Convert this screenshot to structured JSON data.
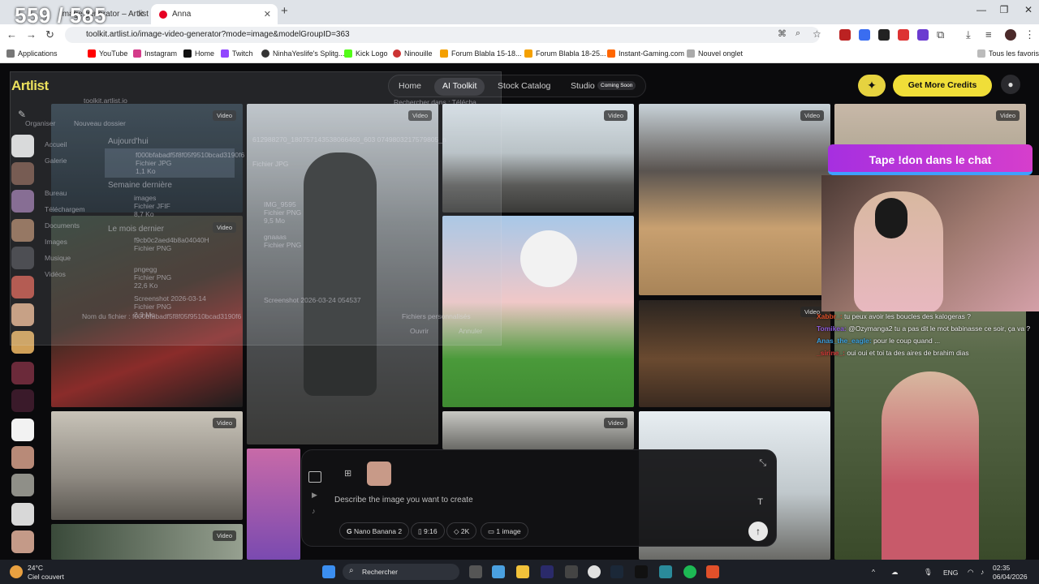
{
  "overlay_counter": "559 / 585",
  "browser": {
    "tabs": [
      {
        "label": "Image generator – Artlist"
      },
      {
        "label": "Anna"
      }
    ],
    "url": "toolkit.artlist.io/image-video-generator?mode=image&modelGroupID=363",
    "bookmarks": [
      {
        "label": "Applications"
      },
      {
        "label": "YouTube"
      },
      {
        "label": "Instagram"
      },
      {
        "label": "Home"
      },
      {
        "label": "Twitch"
      },
      {
        "label": "NinhaYeslife's Splitg..."
      },
      {
        "label": "Kick Logo"
      },
      {
        "label": "Ninouille"
      },
      {
        "label": "Forum Blabla 15-18..."
      },
      {
        "label": "Forum Blabla 18-25..."
      },
      {
        "label": "Instant-Gaming.com"
      },
      {
        "label": "Nouvel onglet"
      }
    ],
    "all_bookmarks": "Tous les favoris"
  },
  "artlist": {
    "logo": "Artlist",
    "nav": {
      "home": "Home",
      "ai_toolkit": "AI Toolkit",
      "stock": "Stock Catalog",
      "studio": "Studio",
      "coming_soon": "Coming Soon"
    },
    "credits_button": "Get More Credits",
    "video_badge": "Video",
    "prompt": {
      "placeholder": "Describe the image you want to create",
      "model": "Nano Banana 2",
      "ratio": "9:16",
      "resolution": "2K",
      "count": "1 image"
    }
  },
  "file_dialog": {
    "address": "toolkit.artlist.io",
    "search": "Rechercher dans : Télécha...",
    "organize": "Organiser",
    "new_folder": "Nouveau dossier",
    "tree": [
      "Accueil",
      "Galerie",
      "Bureau",
      "Téléchargem",
      "Documents",
      "Images",
      "Musique",
      "Vidéos"
    ],
    "groups": [
      "Aujourd'hui",
      "Semaine dernière",
      "Le mois dernier"
    ],
    "files": [
      {
        "name": "f000bfabadf5f8f05f9510bcad3190f6",
        "type": "Fichier JPG",
        "size": "1,1 Ko"
      },
      {
        "name": "612988270_180757143538066460_603 0749803217579805_n",
        "type": "Fichier JPG",
        "size": ""
      },
      {
        "name": "images",
        "type": "Fichier JFIF",
        "size": "8,7 Ko"
      },
      {
        "name": "IMG_9595",
        "type": "Fichier PNG",
        "size": "9,5 Mo"
      },
      {
        "name": "f9cb0c2aed4b8a04040H",
        "type": "Fichier PNG",
        "size": ""
      },
      {
        "name": "gnaaas",
        "type": "Fichier PNG",
        "size": ""
      },
      {
        "name": "pngegg",
        "type": "Fichier PNG",
        "size": "22,6 Ko"
      },
      {
        "name": "Screenshot 2026-03-14",
        "type": "Fichier PNG",
        "size": "2,3 Mo"
      },
      {
        "name": "Screenshot 2026-03-24 054537",
        "type": "",
        "size": ""
      }
    ],
    "filename_label": "Nom du fichier :",
    "filename_value": "f000bfabadf5f8f05f9510bcad3190f6",
    "filter": "Fichiers personnalisés",
    "open": "Ouvrir",
    "cancel": "Annuler"
  },
  "stream": {
    "banner": "Tape !don dans le chat",
    "chat": [
      {
        "user": "Xabbr_:",
        "text": "tu peux avoir les boucles des kalogeras ?"
      },
      {
        "user": "Tomikea:",
        "text": "@Ozymanga2 tu a pas dit le mot babinasse ce soir, ça va ?"
      },
      {
        "user": "Anas_the_eagle:",
        "text": "pour le coup quand ..."
      },
      {
        "user": "_sirine_:",
        "text": "oui oui et toi ta des aires de brahim dias"
      }
    ]
  },
  "taskbar": {
    "temperature": "24°C",
    "weather": "Ciel couvert",
    "search": "Rechercher",
    "lang": "ENG",
    "time": "02:35",
    "date": "06/04/2026"
  }
}
